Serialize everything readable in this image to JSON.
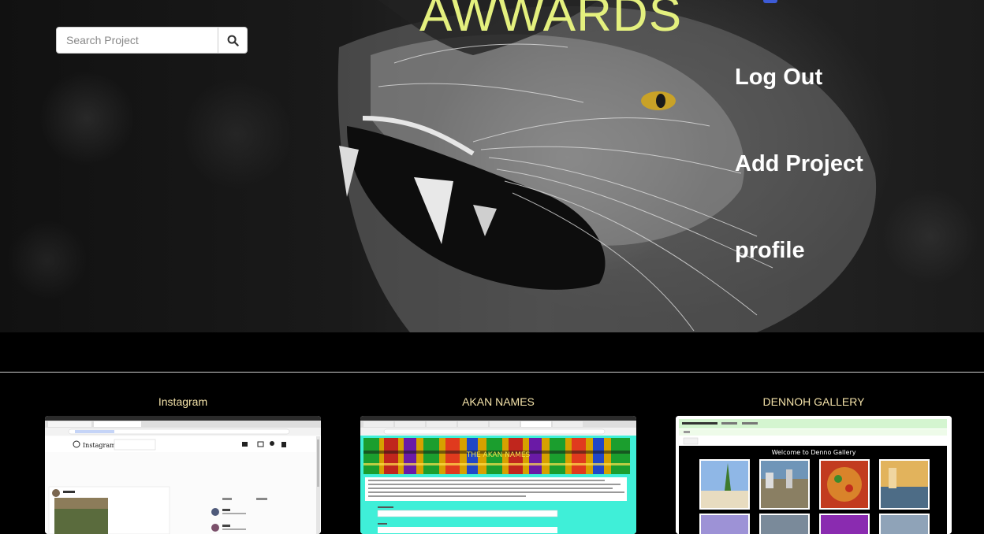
{
  "header": {
    "brand": "AWWARDS",
    "search": {
      "placeholder": "Search Project",
      "value": ""
    },
    "nav": [
      "Log Out",
      "Add Project",
      "profile"
    ]
  },
  "projects": [
    {
      "title": "Instagram",
      "thumbnail_text": "Instagram"
    },
    {
      "title": "AKAN NAMES",
      "thumbnail_text": "THE AKAN NAMES"
    },
    {
      "title": "DENNOH GALLERY",
      "thumbnail_text": "Welcome to Denno Gallery"
    }
  ],
  "colors": {
    "brand": "#e4f07e",
    "card_title": "#f3e2a9",
    "nav": "#ffffff",
    "background": "#000000"
  }
}
